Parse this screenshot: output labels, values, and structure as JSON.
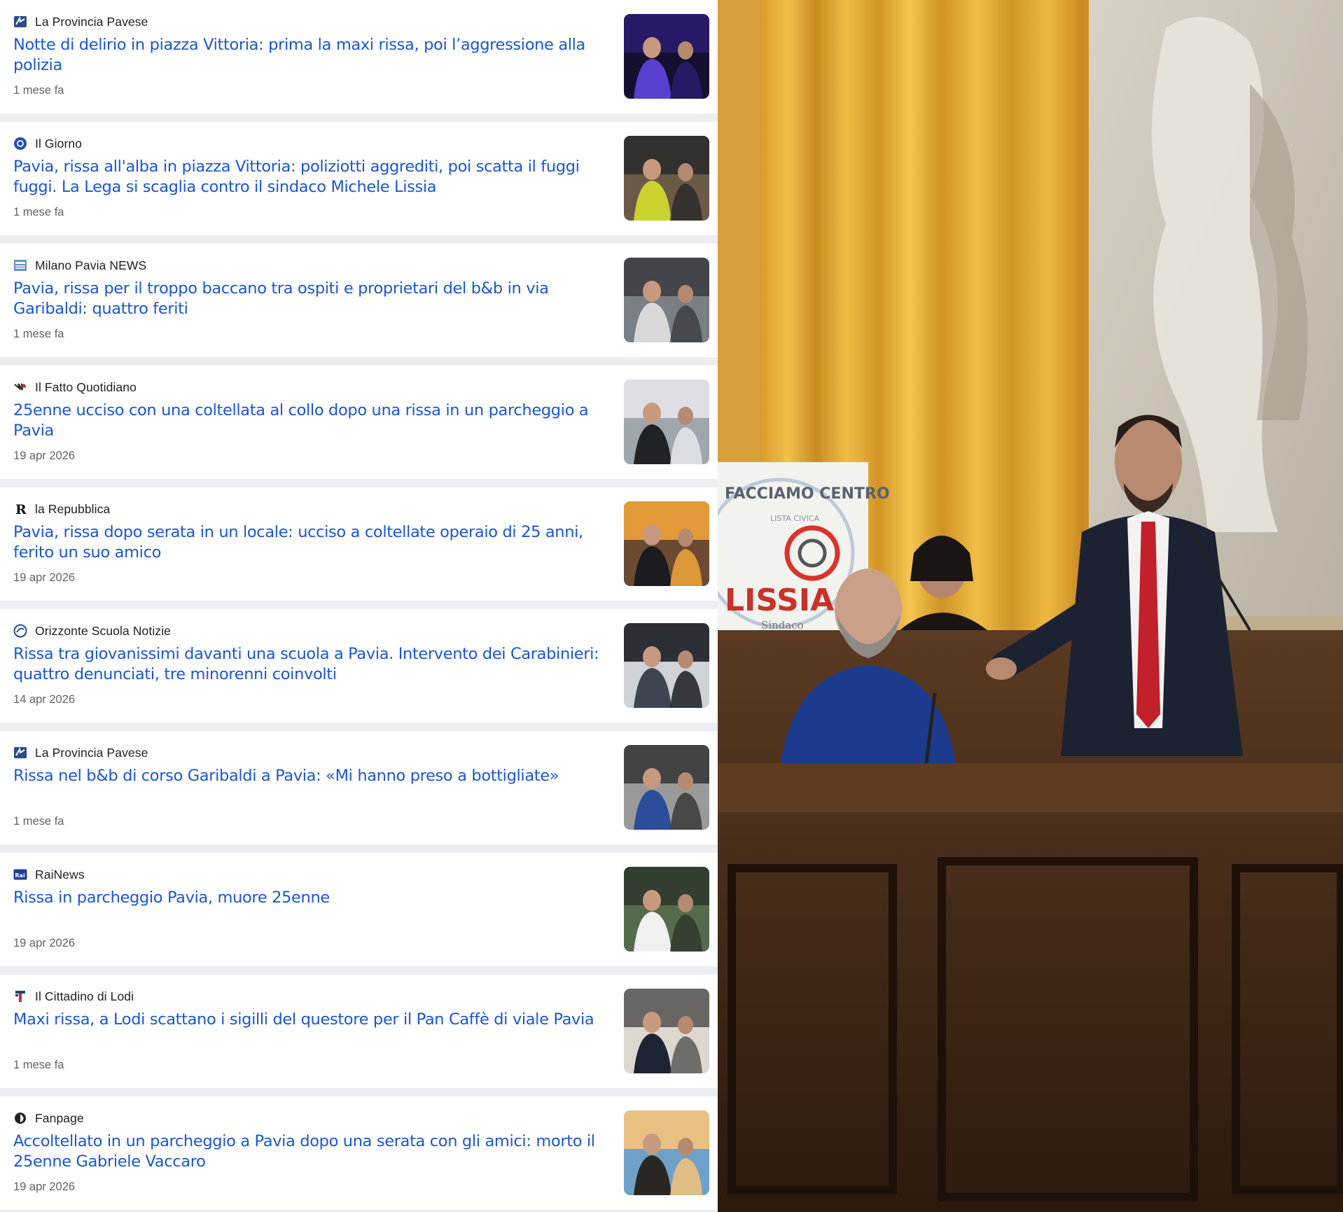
{
  "news_items": [
    {
      "source": "La Provincia Pavese",
      "icon": "provincia-pavese-logo",
      "title": "Notte di delirio in piazza Vittoria: prima la maxi rissa, poi l’aggressione alla polizia",
      "time": "1 mese fa",
      "thumb": "police-night-thumbnail"
    },
    {
      "source": "Il Giorno",
      "icon": "il-giorno-logo",
      "title": "Pavia, rissa all'alba in piazza Vittoria: poliziotti aggrediti, poi scatta il fuggi fuggi. La Lega si scaglia contro il sindaco Michele Lissia",
      "time": "1 mese fa",
      "thumb": "paramedics-square-thumbnail"
    },
    {
      "source": "Milano Pavia NEWS",
      "icon": "milano-pavia-news-logo",
      "title": "Pavia, rissa per il troppo baccano tra ospiti e proprietari del b&b in via Garibaldi: quattro feriti",
      "time": "1 mese fa",
      "thumb": "carabinieri-car-thumbnail"
    },
    {
      "source": "Il Fatto Quotidiano",
      "icon": "fatto-quotidiano-logo",
      "title": "25enne ucciso con una coltellata al collo dopo una rissa in un parcheggio a Pavia",
      "time": "19 apr 2026",
      "thumb": "young-man-portrait-thumbnail"
    },
    {
      "source": "la Repubblica",
      "icon": "repubblica-logo",
      "title": "Pavia, rissa dopo serata in un locale: ucciso a coltellate operaio di 25 anni, ferito un suo amico",
      "time": "19 apr 2026",
      "thumb": "young-man-suit-thumbnail"
    },
    {
      "source": "Orizzonte Scuola Notizie",
      "icon": "orizzonte-scuola-logo",
      "title": "Rissa tra giovanissimi davanti una scuola a Pavia. Intervento dei Carabinieri: quattro denunciati, tre minorenni coinvolti",
      "time": "14 apr 2026",
      "thumb": "carabinieri-car-night-thumbnail"
    },
    {
      "source": "La Provincia Pavese",
      "icon": "provincia-pavese-logo",
      "title": "Rissa nel b&b di corso Garibaldi a Pavia: «Mi hanno preso a bottigliate»",
      "time": "1 mese fa",
      "thumb": "police-car-street-thumbnail"
    },
    {
      "source": "RaiNews",
      "icon": "rainews-logo",
      "title": "Rissa in parcheggio Pavia, muore 25enne",
      "time": "19 apr 2026",
      "thumb": "parking-lot-thumbnail"
    },
    {
      "source": "Il Cittadino di Lodi",
      "icon": "cittadino-lodi-logo",
      "title": "Maxi rissa, a Lodi scattano i sigilli del questore per il Pan Caffè di viale Pavia",
      "time": "1 mese fa",
      "thumb": "police-sealing-door-thumbnail"
    },
    {
      "source": "Fanpage",
      "icon": "fanpage-logo",
      "title": "Accoltellato in un parcheggio a Pavia dopo una serata con gli amici: morto il 25enne Gabriele Vaccaro",
      "time": "19 apr 2026",
      "thumb": "young-man-sunset-thumbnail"
    }
  ],
  "photo": {
    "banner_top": "FACCIAMO CENTRO",
    "banner_sub": "LISTA CIVICA",
    "banner_name": "LISSIA",
    "banner_role": "Sindaco"
  },
  "colors": {
    "headline": "#1a56d6",
    "source": "#202124",
    "time": "#5f6368",
    "separator": "#eceef1"
  }
}
